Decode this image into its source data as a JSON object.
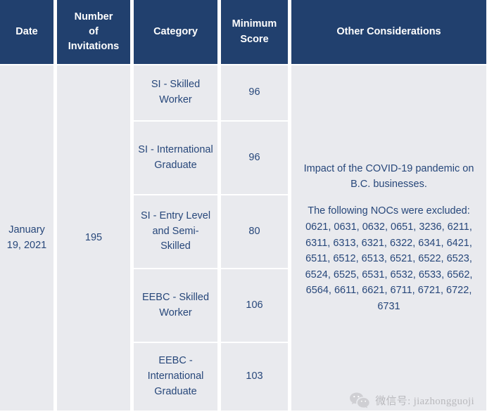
{
  "table": {
    "columns": [
      {
        "key": "date",
        "label": "Date"
      },
      {
        "key": "invitations",
        "label": "Number of Invitations",
        "label_line1": "Number",
        "label_line2": "of",
        "label_line3": "Invitations"
      },
      {
        "key": "category",
        "label": "Category"
      },
      {
        "key": "min_score",
        "label": "Minimum Score",
        "label_line1": "Minimum",
        "label_line2": "Score"
      },
      {
        "key": "other",
        "label": "Other Considerations"
      }
    ],
    "row": {
      "date": "January 19, 2021",
      "invitations": "195",
      "categories": [
        {
          "name": "SI - Skilled Worker",
          "min_score": "96"
        },
        {
          "name": "SI - International Graduate",
          "min_score": "96"
        },
        {
          "name": "SI - Entry Level and Semi-Skilled",
          "min_score": "80"
        },
        {
          "name": "EEBC - Skilled Worker",
          "min_score": "106"
        },
        {
          "name": "EEBC - International Graduate",
          "min_score": "103"
        }
      ],
      "other_considerations": {
        "paragraph1": "Impact of the COVID-19 pandemic on B.C. businesses.",
        "paragraph2_intro": "The following NOCs were excluded:",
        "noc_codes": "0621, 0631, 0632, 0651, 3236, 6211, 6311, 6313, 6321, 6322, 6341, 6421, 6511, 6512, 6513, 6521, 6522, 6523, 6524, 6525, 6531, 6532, 6533, 6562, 6564, 6611, 6621, 6711, 6721, 6722, 6731"
      }
    }
  },
  "watermark": {
    "icon": "wechat-icon",
    "text": "微信号: jiazhongguoji"
  },
  "colors": {
    "header_bg": "#21406e",
    "header_text": "#ffffff",
    "cell_bg": "#e9eaee",
    "cell_text": "#27477a",
    "page_bg": "#ffffff",
    "watermark_text": "#b9b9bd"
  }
}
